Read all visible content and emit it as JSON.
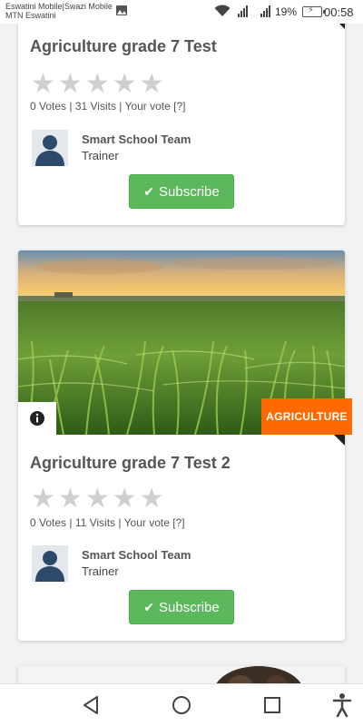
{
  "status_bar": {
    "carrier_line1": "Eswatini Mobile|Swazi Mobile",
    "carrier_line2": "MTN Eswatini",
    "battery": "19%",
    "time": "00:58"
  },
  "courses": [
    {
      "title": "Agriculture grade 7 Test",
      "votes": "0 Votes | 31 Visits | Your vote [?]",
      "trainer_name": "Smart School Team",
      "trainer_role": "Trainer",
      "subscribe_label": "Subscribe"
    },
    {
      "title": "Agriculture grade 7 Test 2",
      "category": "AGRICULTURE",
      "votes": "0 Votes | 11 Visits | Your vote [?]",
      "trainer_name": "Smart School Team",
      "trainer_role": "Trainer",
      "subscribe_label": "Subscribe"
    }
  ],
  "colors": {
    "subscribe": "#5cb85c",
    "badge": "#ff6a00",
    "star_empty": "#cfcfcf"
  },
  "icons": [
    "gallery-icon",
    "wifi-icon",
    "signal-icon",
    "battery-icon",
    "info-icon",
    "check-icon",
    "back-icon",
    "home-icon",
    "recents-icon",
    "accessibility-icon"
  ]
}
